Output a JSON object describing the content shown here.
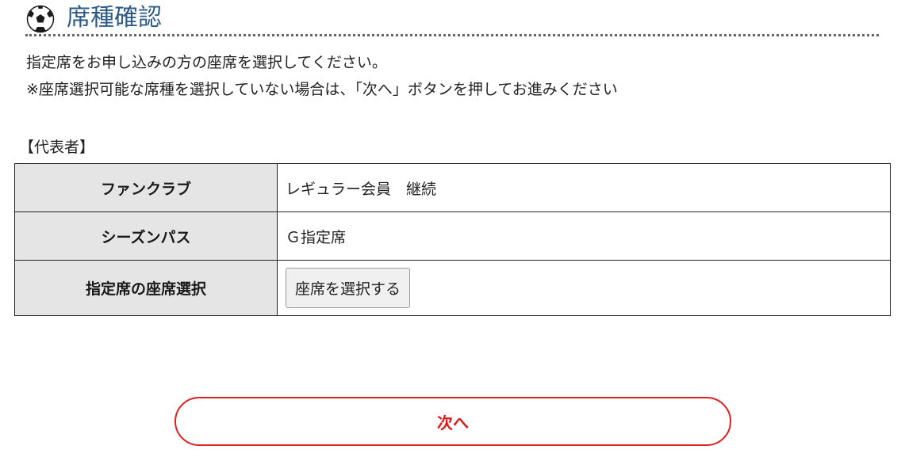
{
  "header": {
    "icon": "soccer-ball-icon",
    "title": "席種確認",
    "title_color": "#2e5a87"
  },
  "intro": {
    "line1": "指定席をお申し込みの方の座席を選択してください。",
    "line2": "※座席選択可能な席種を選択していない場合は、「次へ」ボタンを押してお進みください"
  },
  "representative": {
    "label": "【代表者】",
    "rows": [
      {
        "header": "ファンクラブ",
        "value": "レギュラー会員　継続"
      },
      {
        "header": "シーズンパス",
        "value": "Ｇ指定席"
      },
      {
        "header": "指定席の座席選択",
        "button_label": "座席を選択する"
      }
    ]
  },
  "footer": {
    "next_label": "次へ",
    "accent_color": "#e01818"
  }
}
